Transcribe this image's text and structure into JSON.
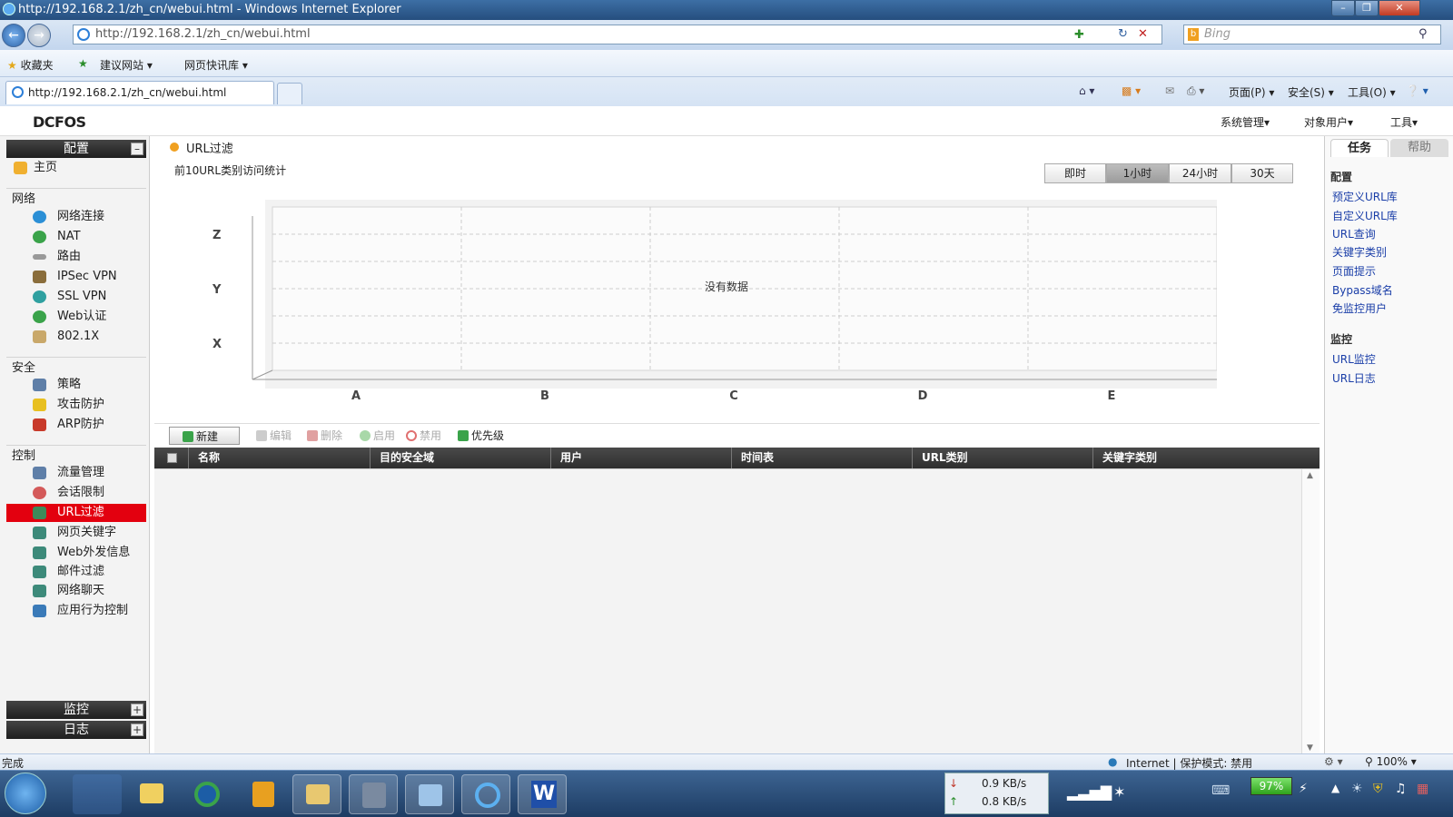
{
  "window": {
    "title": "http://192.168.2.1/zh_cn/webui.html - Windows Internet Explorer",
    "address": "http://192.168.2.1/zh_cn/webui.html",
    "search_placeholder": "Bing",
    "tab_title": "http://192.168.2.1/zh_cn/webui.html",
    "favorites": {
      "label": "收藏夹",
      "items": [
        "建议网站",
        "网页快讯库"
      ]
    },
    "commands": [
      "页面(P)",
      "安全(S)",
      "工具(O)"
    ]
  },
  "app": {
    "logo": "DCFOS",
    "top_menu": [
      "系统管理",
      "对象用户",
      "工具"
    ]
  },
  "sidebar": {
    "config_title": "配置",
    "home": "主页",
    "sections": [
      {
        "title": "网络",
        "items": [
          "网络连接",
          "NAT",
          "路由",
          "IPSec VPN",
          "SSL VPN",
          "Web认证",
          "802.1X"
        ]
      },
      {
        "title": "安全",
        "items": [
          "策略",
          "攻击防护",
          "ARP防护"
        ]
      },
      {
        "title": "控制",
        "items": [
          "流量管理",
          "会话限制",
          "URL过滤",
          "网页关键字",
          "Web外发信息",
          "邮件过滤",
          "网络聊天",
          "应用行为控制"
        ]
      }
    ],
    "active_item": "URL过滤",
    "monitor_title": "监控",
    "log_title": "日志"
  },
  "main": {
    "breadcrumb": "URL过滤",
    "chart_title": "前10URL类别访问统计",
    "time_buttons": [
      "即时",
      "1小时",
      "24小时",
      "30天"
    ],
    "selected_time": "1小时",
    "no_data": "没有数据",
    "toolbar": {
      "new": "新建",
      "edit": "编辑",
      "delete": "删除",
      "enable": "启用",
      "disable": "禁用",
      "priority": "优先级"
    },
    "table_columns": [
      "名称",
      "目的安全域",
      "用户",
      "时间表",
      "URL类别",
      "关键字类别"
    ]
  },
  "chart_data": {
    "type": "bar",
    "categories": [
      "A",
      "B",
      "C",
      "D",
      "E"
    ],
    "y_categories": [
      "X",
      "Y",
      "Z"
    ],
    "series": [],
    "title": "前10URL类别访问统计",
    "annotation": "没有数据",
    "grid": true
  },
  "right_panel": {
    "tabs": [
      "任务",
      "帮助"
    ],
    "config_title": "配置",
    "config_links": [
      "预定义URL库",
      "自定义URL库",
      "URL查询",
      "关键字类别",
      "页面提示",
      "Bypass域名",
      "免监控用户"
    ],
    "monitor_title": "监控",
    "monitor_links": [
      "URL监控",
      "URL日志"
    ]
  },
  "statusbar": {
    "left": "完成",
    "zone": "Internet | 保护模式: 禁用",
    "zoom": "100%"
  },
  "taskbar": {
    "download": "0.9 KB/s",
    "upload": "0.8 KB/s",
    "battery": "97%"
  }
}
